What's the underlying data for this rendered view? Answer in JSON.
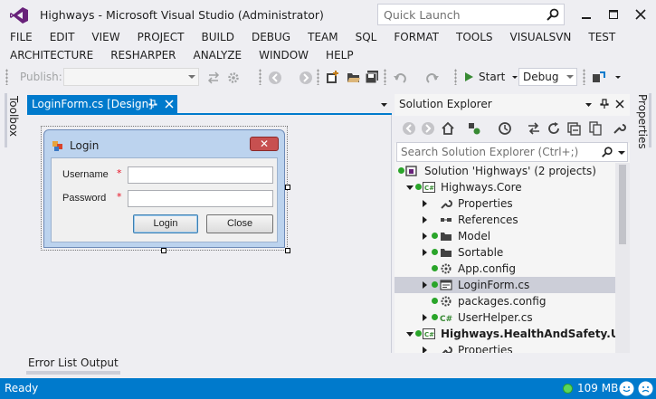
{
  "window": {
    "title": "Highways - Microsoft Visual Studio (Administrator)",
    "quick_launch_placeholder": "Quick Launch"
  },
  "menu": {
    "row1": [
      "FILE",
      "EDIT",
      "VIEW",
      "PROJECT",
      "BUILD",
      "DEBUG",
      "TEAM",
      "SQL",
      "FORMAT",
      "TOOLS",
      "VISUALSVN",
      "TEST"
    ],
    "row2": [
      "ARCHITECTURE",
      "RESHARPER",
      "ANALYZE",
      "WINDOW",
      "HELP"
    ]
  },
  "toolbar": {
    "publish_label": "Publish:",
    "start_label": "Start",
    "config_value": "Debug"
  },
  "side_tabs": {
    "left": "Toolbox",
    "right": "Properties"
  },
  "document": {
    "tab_label": "LoginForm.cs [Design]"
  },
  "login_form": {
    "title": "Login",
    "close_glyph": "✕",
    "username_label": "Username",
    "password_label": "Password",
    "required_marker": "*",
    "login_button": "Login",
    "close_button": "Close"
  },
  "solution_explorer": {
    "title": "Solution Explorer",
    "search_placeholder": "Search Solution Explorer (Ctrl+;)",
    "items": [
      {
        "label": "Solution 'Highways' (2 projects)",
        "icon": "solution-icon",
        "expander": "none"
      },
      {
        "label": "Highways.Core",
        "icon": "csharp-project-icon",
        "expander": "open"
      },
      {
        "label": "Properties",
        "icon": "wrench-icon",
        "expander": "closed"
      },
      {
        "label": "References",
        "icon": "references-icon",
        "expander": "closed"
      },
      {
        "label": "Model",
        "icon": "folder-icon",
        "expander": "closed"
      },
      {
        "label": "Sortable",
        "icon": "folder-icon",
        "expander": "closed"
      },
      {
        "label": "App.config",
        "icon": "config-file-icon",
        "expander": "none"
      },
      {
        "label": "LoginForm.cs",
        "icon": "form-icon",
        "expander": "closed"
      },
      {
        "label": "packages.config",
        "icon": "config-file-icon",
        "expander": "none"
      },
      {
        "label": "UserHelper.cs",
        "icon": "csharp-file-icon",
        "expander": "closed"
      },
      {
        "label": "Highways.HealthAndSafety.UI",
        "icon": "csharp-project-icon",
        "expander": "open"
      },
      {
        "label": "Properties",
        "icon": "wrench-icon",
        "expander": "closed"
      }
    ]
  },
  "bottom_tabs": [
    "Error List",
    "Output"
  ],
  "status": {
    "text": "Ready",
    "memory": "109 MB"
  },
  "colors": {
    "accent": "#007acc",
    "chrome": "#eeeef2",
    "project_dot": "#2aa52a"
  }
}
